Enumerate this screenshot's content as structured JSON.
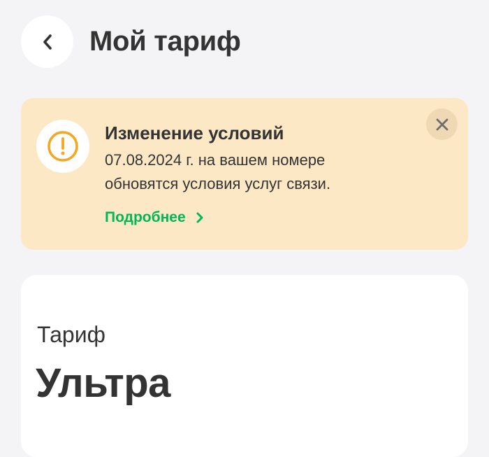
{
  "header": {
    "title": "Мой тариф",
    "back_icon": "chevron-left-icon"
  },
  "notice": {
    "title": "Изменение условий",
    "body_lines": [
      "07.08.2024 г. на вашем номере",
      "обновятся условия услуг связи."
    ],
    "link_label": "Подробнее",
    "icon": "exclamation-circle-icon",
    "close_icon": "close-icon"
  },
  "tariff": {
    "label": "Тариф",
    "name": "Ультра"
  },
  "colors": {
    "background": "#f4f4f6",
    "notice_bg": "#fde8c6",
    "accent_green": "#00b956",
    "warning_orange": "#f5a623",
    "text": "#333333"
  }
}
